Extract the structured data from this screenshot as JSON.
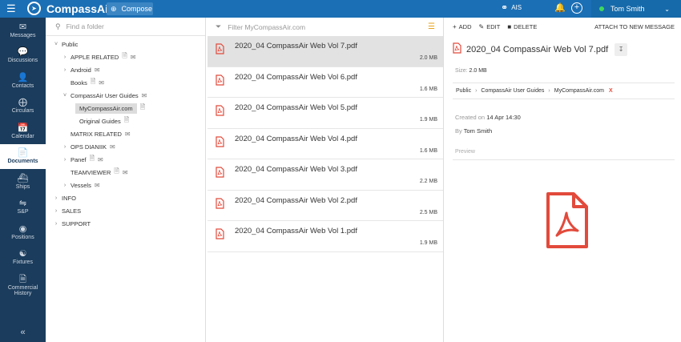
{
  "topbar": {
    "brand": "CompassAir",
    "compose_label": "Compose",
    "ais_label": "AIS",
    "user_name": "Tom Smith"
  },
  "sidebar": {
    "items": [
      {
        "label": "Messages",
        "icon": "envelope-icon"
      },
      {
        "label": "Discussions",
        "icon": "chat-icon"
      },
      {
        "label": "Contacts",
        "icon": "person-icon"
      },
      {
        "label": "Circulars",
        "icon": "circular-icon"
      },
      {
        "label": "Calendar",
        "icon": "calendar-icon"
      },
      {
        "label": "Documents",
        "icon": "document-icon",
        "active": true
      },
      {
        "label": "Ships",
        "icon": "ship-icon"
      },
      {
        "label": "S&P",
        "icon": "sp-icon"
      },
      {
        "label": "Positions",
        "icon": "positions-icon"
      },
      {
        "label": "Fixtures",
        "icon": "fixtures-icon"
      },
      {
        "label": "Commercial",
        "label2": "History",
        "icon": "history-icon"
      }
    ]
  },
  "folders": {
    "search_placeholder": "Find a folder",
    "tree": [
      {
        "label": "Public",
        "depth": 0,
        "arrow": "v"
      },
      {
        "label": "APPLE RELATED",
        "depth": 1,
        "arrow": ">",
        "flags": [
          "file",
          "mail"
        ]
      },
      {
        "label": "Android",
        "depth": 1,
        "arrow": ">",
        "flags": [
          "mail"
        ]
      },
      {
        "label": "Books",
        "depth": 1,
        "arrow": "",
        "flags": [
          "file",
          "mail"
        ]
      },
      {
        "label": "CompassAir User Guides",
        "depth": 1,
        "arrow": "v",
        "flags": [
          "mail"
        ]
      },
      {
        "label": "MyCompassAir.com",
        "depth": 2,
        "arrow": "",
        "flags": [
          "file"
        ],
        "selected": true
      },
      {
        "label": "Original Guides",
        "depth": 2,
        "arrow": "",
        "flags": [
          "file"
        ]
      },
      {
        "label": "MATRIX RELATED",
        "depth": 1,
        "arrow": "",
        "flags": [
          "mail"
        ]
      },
      {
        "label": "OPS DIANIIK",
        "depth": 1,
        "arrow": ">",
        "flags": [
          "mail"
        ]
      },
      {
        "label": "Panef",
        "depth": 1,
        "arrow": ">",
        "flags": [
          "file",
          "mail"
        ]
      },
      {
        "label": "TEAMVIEWER",
        "depth": 1,
        "arrow": "",
        "flags": [
          "file",
          "mail"
        ]
      },
      {
        "label": "Vessels",
        "depth": 1,
        "arrow": ">",
        "flags": [
          "mail"
        ]
      },
      {
        "label": "INFO",
        "depth": 0,
        "arrow": ">"
      },
      {
        "label": "SALES",
        "depth": 0,
        "arrow": ">"
      },
      {
        "label": "SUPPORT",
        "depth": 0,
        "arrow": ">"
      }
    ]
  },
  "files": {
    "filter_placeholder": "Filter MyCompassAir.com",
    "items": [
      {
        "name": "2020_04 CompassAir Web Vol 7.pdf",
        "size": "2.0 MB",
        "selected": true
      },
      {
        "name": "2020_04 CompassAir Web Vol 6.pdf",
        "size": "1.6 MB"
      },
      {
        "name": "2020_04 CompassAir Web Vol 5.pdf",
        "size": "1.9 MB"
      },
      {
        "name": "2020_04 CompassAir Web Vol 4.pdf",
        "size": "1.6 MB"
      },
      {
        "name": "2020_04 CompassAir Web Vol 3.pdf",
        "size": "2.2 MB"
      },
      {
        "name": "2020_04 CompassAir Web Vol 2.pdf",
        "size": "2.5 MB"
      },
      {
        "name": "2020_04 CompassAir Web Vol 1.pdf",
        "size": "1.9 MB"
      }
    ]
  },
  "detail": {
    "add_label": "ADD",
    "edit_label": "EDIT",
    "delete_label": "DELETE",
    "attach_label": "ATTACH TO NEW MESSAGE",
    "title": "2020_04 CompassAir Web Vol 7.pdf",
    "size_label": "Size:",
    "size_value": "2.0 MB",
    "breadcrumb": [
      "Public",
      "CompassAir User Guides",
      "MyCompassAir.com"
    ],
    "breadcrumb_close": "X",
    "created_label": "Created on",
    "created_value": "14 Apr 14:30",
    "by_label": "By",
    "by_value": "Tom Smith",
    "preview_label": "Preview"
  },
  "colors": {
    "topbar": "#1b6fb5",
    "sidebar": "#1b3c5c",
    "pdf_red": "#e24a3b",
    "online_green": "#3fd85a"
  }
}
